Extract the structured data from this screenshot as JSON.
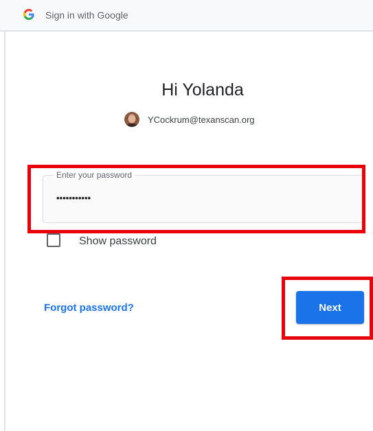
{
  "header": {
    "title": "Sign in with Google",
    "logo_icon": "google-g-icon"
  },
  "main": {
    "greeting": "Hi Yolanda",
    "account": {
      "email": "YCockrum@texanscan.org",
      "avatar_icon": "user-avatar"
    },
    "password_field": {
      "label": "Enter your password",
      "value": "•••••••••••"
    },
    "show_password": {
      "label": "Show password",
      "checked": false
    },
    "forgot_password_label": "Forgot password?",
    "next_label": "Next"
  },
  "annotations": {
    "highlight_color": "#e8000b"
  },
  "colors": {
    "primary_blue": "#1a73e8",
    "text_dark": "#202124",
    "text_muted": "#5f6368",
    "header_bg": "#f8f9fa"
  }
}
